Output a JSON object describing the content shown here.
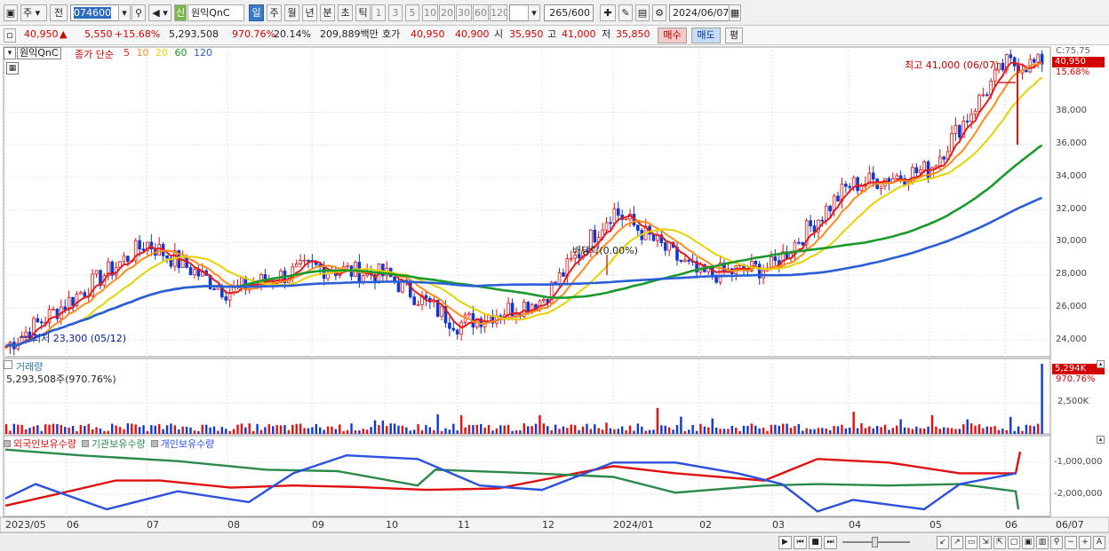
{
  "toolbar": {
    "period_select": "주",
    "prev_btn": "전",
    "code": "074600",
    "name_tag": "신",
    "name": "원익QnC",
    "tf_day": "일",
    "tf_week": "주",
    "tf_month": "월",
    "tf_year": "년",
    "tf_min": "분",
    "tf_sec": "초",
    "tf_tick": "틱",
    "intervals": [
      "1",
      "3",
      "5",
      "10",
      "20",
      "30",
      "60",
      "120"
    ],
    "count": "265",
    "count_total": "/600",
    "date": "2024/06/07"
  },
  "quote": {
    "price": "40,950",
    "arrow": "▲",
    "change": "5,550",
    "change_pct": "+15.68%",
    "volume": "5,293,508",
    "vol_ratio": "970.76%",
    "turnover": "20.14%",
    "amount": "209,889백만",
    "bid_label": "호가",
    "ask": "40,950",
    "bid": "40,900",
    "open_label": "시",
    "open": "35,950",
    "high_label": "고",
    "high": "41,000",
    "low_label": "저",
    "low": "35,850",
    "buy_btn": "매수",
    "sell_btn": "매도",
    "eval_btn": "평"
  },
  "price_panel": {
    "stock_tag": "원익QnC",
    "ma_title": "종가 단순",
    "ma": [
      {
        "period": "5",
        "color": "#e61a1a"
      },
      {
        "period": "10",
        "color": "#ff8c1a"
      },
      {
        "period": "20",
        "color": "#e6d200"
      },
      {
        "period": "60",
        "color": "#1a9a2a"
      },
      {
        "period": "120",
        "color": "#2a5ed8"
      }
    ],
    "top_label": "C:75.75",
    "price_box": "40,950",
    "pct_label": "15.68%",
    "high_annot": "최고 41,000 (06/07)",
    "low_annot": "최저 23,300 (05/12)",
    "div_annot": "배당락(0.00%)"
  },
  "volume_panel": {
    "title": "거래량",
    "value": "5,293,508주(970.76%)",
    "box": "5,294K",
    "pct": "970.76%",
    "tick": "2,500K"
  },
  "holdings_panel": {
    "legend": [
      {
        "label": "외국인보유수량",
        "color": "#e01010"
      },
      {
        "label": "기관보유수량",
        "color": "#2a8a4a"
      },
      {
        "label": "개인보유수량",
        "color": "#2a50e0"
      }
    ],
    "ticks": [
      "-1,000,000",
      "-2,000,000"
    ]
  },
  "x_axis": [
    "2023/05",
    "06",
    "07",
    "08",
    "09",
    "10",
    "11",
    "12",
    "2024/01",
    "02",
    "03",
    "04",
    "05",
    "06",
    "06/07"
  ],
  "chart_data": {
    "type": "line",
    "price_axis": {
      "ticks": [
        24000,
        26000,
        28000,
        30000,
        32000,
        34000,
        36000,
        38000
      ],
      "ylim": [
        23000,
        42000
      ]
    },
    "close": [
      {
        "month": "2023/05",
        "value": 23600
      },
      {
        "month": "06",
        "value": 26300
      },
      {
        "month": "07",
        "value": 30000
      },
      {
        "month": "08",
        "value": 27000
      },
      {
        "month": "09",
        "value": 28500
      },
      {
        "month": "10",
        "value": 28000
      },
      {
        "month": "11",
        "value": 25000
      },
      {
        "month": "12",
        "value": 26500
      },
      {
        "month": "2024/01",
        "value": 32000
      },
      {
        "month": "02",
        "value": 28000
      },
      {
        "month": "03",
        "value": 28500
      },
      {
        "month": "04",
        "value": 33500
      },
      {
        "month": "05",
        "value": 34500
      },
      {
        "month": "06",
        "value": 40950
      }
    ]
  }
}
